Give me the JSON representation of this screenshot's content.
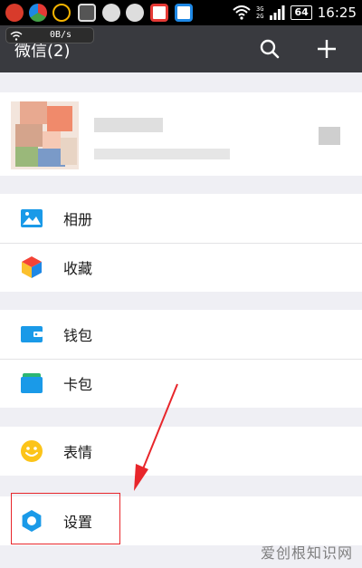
{
  "status_bar": {
    "network_top": "3G",
    "network_bottom": "2G",
    "battery": "64",
    "time": "16:25"
  },
  "speed_widget": {
    "speed": "0B/s"
  },
  "header": {
    "title": "微信(2)"
  },
  "menu": {
    "album": "相册",
    "favorites": "收藏",
    "wallet": "钱包",
    "cards": "卡包",
    "stickers": "表情",
    "settings": "设置"
  },
  "colors": {
    "header_bg": "#393a3f",
    "page_bg": "#efeff4",
    "icon_blue": "#1a9ae8",
    "highlight_red": "#e8262b"
  },
  "icons": [
    "search-icon",
    "plus-icon",
    "album-icon",
    "favorites-icon",
    "wallet-icon",
    "cards-icon",
    "stickers-icon",
    "settings-icon"
  ],
  "watermark": "爱创根知识网"
}
